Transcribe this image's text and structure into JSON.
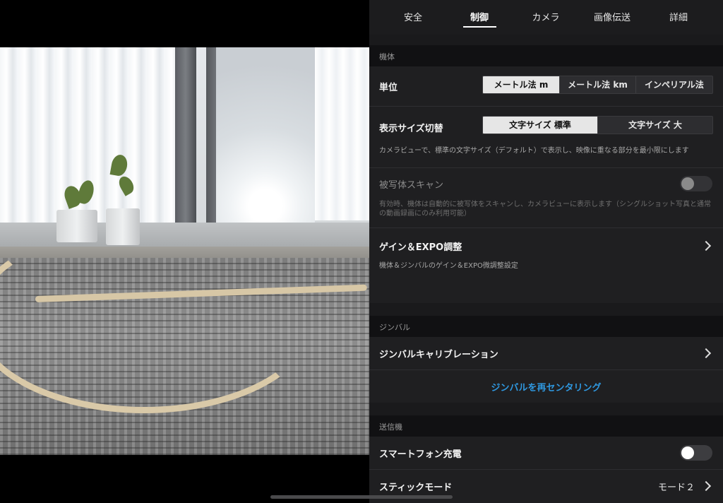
{
  "tabs": [
    {
      "label": "安全"
    },
    {
      "label": "制御"
    },
    {
      "label": "カメラ"
    },
    {
      "label": "画像伝送"
    },
    {
      "label": "詳細"
    }
  ],
  "active_tab": "制御",
  "sections": {
    "aircraft": {
      "header": "機体",
      "units": {
        "label": "単位",
        "options": [
          "メートル法 m",
          "メートル法 km",
          "インペリアル法"
        ],
        "selected": "メートル法 m"
      },
      "display_size": {
        "label": "表示サイズ切替",
        "options": [
          "文字サイズ 標準",
          "文字サイズ 大"
        ],
        "selected": "文字サイズ 標準",
        "description": "カメラビューで、標準の文字サイズ（デフォルト）で表示し、映像に重なる部分を最小限にします"
      },
      "subject_scan": {
        "label": "被写体スキャン",
        "enabled": false,
        "disabled": true,
        "description": "有効時、機体は自動的に被写体をスキャンし、カメラビューに表示します（シングルショット写真と通常の動画録画にのみ利用可能）"
      },
      "gain_expo": {
        "label": "ゲイン＆EXPO調整",
        "description": "機体＆ジンバルのゲイン＆EXPO微調整設定"
      }
    },
    "gimbal": {
      "header": "ジンバル",
      "calibration": {
        "label": "ジンバルキャリブレーション"
      },
      "recenter": {
        "label": "ジンバルを再センタリング"
      }
    },
    "transmitter": {
      "header": "送信機",
      "phone_charging": {
        "label": "スマートフォン充電",
        "enabled": false
      },
      "stick_mode": {
        "label": "スティックモード",
        "value": "モード２"
      }
    }
  },
  "colors": {
    "panel_bg": "#1a1a1c",
    "row_bg": "#1f1f21",
    "section_bg": "#111113",
    "accent_link": "#2f98e0",
    "selected_segment": "#e6e6e6"
  },
  "icons": {
    "gain_expo": "chevron-right-icon",
    "calibration": "chevron-right-icon",
    "stick_mode": "chevron-right-icon"
  }
}
